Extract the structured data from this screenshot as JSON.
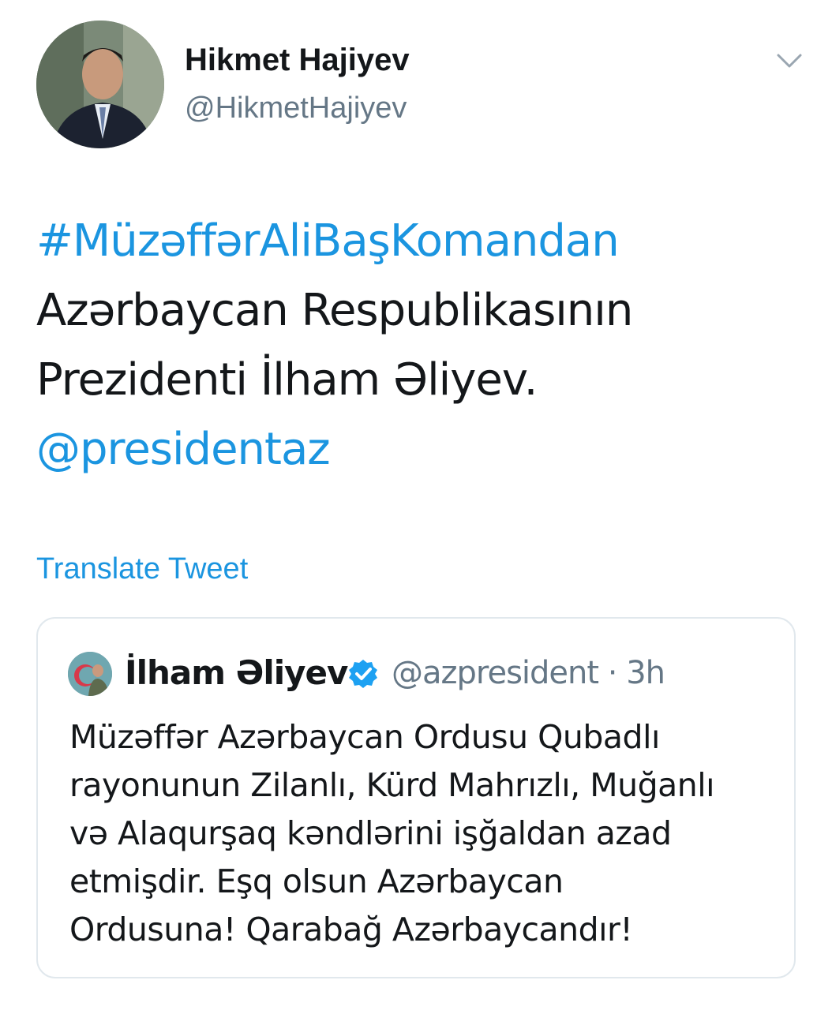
{
  "author": {
    "display_name": "Hikmet Hajiyev",
    "handle": "@HikmetHajiyev",
    "avatar_icon": "profile-photo"
  },
  "menu": {
    "icon": "chevron-down-icon"
  },
  "tweet": {
    "hashtag": "#MüzəffərAliBaşKomandan",
    "line1": "Azərbaycan Respublikasının",
    "line2": "Prezidenti İlham Əliyev.",
    "mention": "@presidentaz"
  },
  "translate_label": "Translate Tweet",
  "quote": {
    "display_name": "İlham Əliyev",
    "verified_icon": "verified-badge-icon",
    "handle_time": "@azpresident · 3h",
    "lines": [
      "Müzəffər Azərbaycan Ordusu Qubadlı",
      "rayonunun Zilanlı, Kürd Mahrızlı, Muğanlı",
      "və Alaqurşaq kəndlərini işğaldan azad",
      "etmişdir. Eşq olsun Azərbaycan",
      "Ordusuna! Qarabağ Azərbaycandır!"
    ]
  },
  "colors": {
    "link": "#1b95e0",
    "text": "#14171a",
    "secondary": "#657786",
    "border": "#e1e8ed"
  }
}
